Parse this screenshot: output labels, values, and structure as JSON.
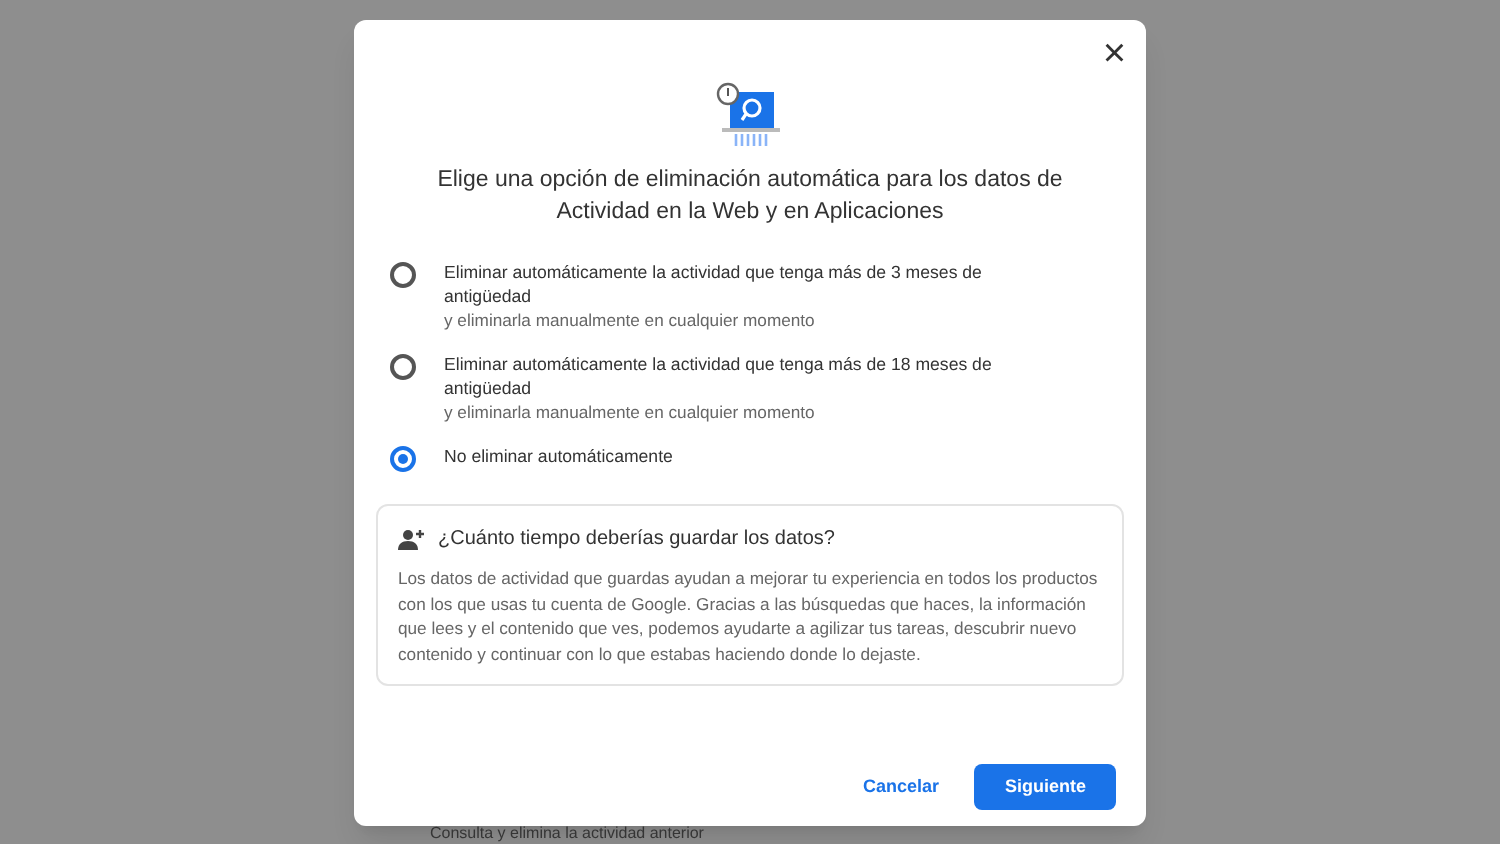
{
  "background": {
    "text": "Consulta y elimina la actividad anterior"
  },
  "dialog": {
    "close": "×",
    "title": "Elige una opción de eliminación automática para los datos de Actividad en la Web y en Aplicaciones",
    "options": [
      {
        "label": "Eliminar automáticamente la actividad que tenga más de 3 meses de antigüedad",
        "sublabel": "y eliminarla manualmente en cualquier momento",
        "selected": false
      },
      {
        "label": "Eliminar automáticamente la actividad que tenga más de 18 meses de antigüedad",
        "sublabel": "y eliminarla manualmente en cualquier momento",
        "selected": false
      },
      {
        "label": "No eliminar automáticamente",
        "selected": true
      }
    ],
    "info": {
      "title": "¿Cuánto tiempo deberías guardar los datos?",
      "body": "Los datos de actividad que guardas ayudan a mejorar tu experiencia en todos los productos con los que usas tu cuenta de Google. Gracias a las búsquedas que haces, la información que lees y el contenido que ves, podemos ayudarte a agilizar tus tareas, descubrir nuevo contenido y continuar con lo que estabas haciendo donde lo dejaste."
    },
    "buttons": [
      {
        "label": "Cancelar",
        "kind": "text"
      },
      {
        "label": "Siguiente",
        "kind": "primary"
      }
    ]
  }
}
